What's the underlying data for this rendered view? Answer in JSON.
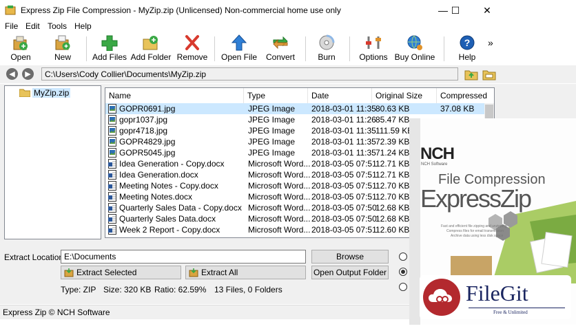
{
  "window": {
    "title": "Express Zip File Compression - MyZip.zip (Unlicensed) Non-commercial home use only",
    "minimize_glyph": "—",
    "maximize_glyph": "☐",
    "close_glyph": "✕"
  },
  "menu": [
    "File",
    "Edit",
    "Tools",
    "Help"
  ],
  "toolbar": {
    "open": "Open",
    "new": "New",
    "add_files": "Add Files",
    "add_folder": "Add Folder",
    "remove": "Remove",
    "open_file": "Open File",
    "convert": "Convert",
    "burn": "Burn",
    "options": "Options",
    "buy_online": "Buy Online",
    "help": "Help",
    "overflow": "»"
  },
  "address": {
    "path": "C:\\Users\\Cody Collier\\Documents\\MyZip.zip"
  },
  "tree": {
    "root": "MyZip.zip"
  },
  "list": {
    "columns": [
      "Name",
      "Type",
      "Date",
      "Original Size",
      "Compressed"
    ],
    "rows": [
      {
        "name": "GOPR0691.jpg",
        "type": "JPEG Image",
        "date": "2018-03-01 11:35",
        "size": "80.63 KB",
        "comp": "37.08 KB",
        "kind": "jpg"
      },
      {
        "name": "gopr1037.jpg",
        "type": "JPEG Image",
        "date": "2018-03-01 11:26",
        "size": "85.47 KB",
        "comp": "",
        "kind": "jpg"
      },
      {
        "name": "gopr4718.jpg",
        "type": "JPEG Image",
        "date": "2018-03-01 11:35",
        "size": "111.59 KB",
        "comp": "",
        "kind": "jpg"
      },
      {
        "name": "GOPR4829.jpg",
        "type": "JPEG Image",
        "date": "2018-03-01 11:35",
        "size": "72.39 KB",
        "comp": "",
        "kind": "jpg"
      },
      {
        "name": "GOPR5045.jpg",
        "type": "JPEG Image",
        "date": "2018-03-01 11:35",
        "size": "71.24 KB",
        "comp": "",
        "kind": "jpg"
      },
      {
        "name": "Idea Generation - Copy.docx",
        "type": "Microsoft Word...",
        "date": "2018-03-05 07:51",
        "size": "12.71 KB",
        "comp": "",
        "kind": "doc"
      },
      {
        "name": "Idea Generation.docx",
        "type": "Microsoft Word...",
        "date": "2018-03-05 07:51",
        "size": "12.71 KB",
        "comp": "",
        "kind": "doc"
      },
      {
        "name": "Meeting Notes - Copy.docx",
        "type": "Microsoft Word...",
        "date": "2018-03-05 07:51",
        "size": "12.70 KB",
        "comp": "",
        "kind": "doc"
      },
      {
        "name": "Meeting Notes.docx",
        "type": "Microsoft Word...",
        "date": "2018-03-05 07:51",
        "size": "12.70 KB",
        "comp": "",
        "kind": "doc"
      },
      {
        "name": "Quarterly Sales Data - Copy.docx",
        "type": "Microsoft Word...",
        "date": "2018-03-05 07:50",
        "size": "12.68 KB",
        "comp": "",
        "kind": "doc"
      },
      {
        "name": "Quarterly Sales Data.docx",
        "type": "Microsoft Word...",
        "date": "2018-03-05 07:50",
        "size": "12.68 KB",
        "comp": "",
        "kind": "doc"
      },
      {
        "name": "Week 2 Report - Copy.docx",
        "type": "Microsoft Word...",
        "date": "2018-03-05 07:51",
        "size": "12.60 KB",
        "comp": "",
        "kind": "doc"
      }
    ]
  },
  "extract": {
    "location_label": "Extract Location:",
    "location_value": "E:\\Documents",
    "browse": "Browse",
    "open_output": "Open Output Folder",
    "extract_selected": "Extract Selected",
    "extract_all": "Extract All"
  },
  "info": {
    "type": "Type: ZIP",
    "size": "Size: 320 KB",
    "ratio": "Ratio: 62.59%",
    "files": "13 Files, 0 Folders"
  },
  "status": "Express Zip © NCH Software",
  "promo": {
    "brand": "NCH",
    "brand_sub": "NCH Software",
    "line1": "File Compression",
    "line2": "ExpressZip",
    "blurb1": "Fast and efficient file zipping and unzipping",
    "blurb2": "Compress files for email transmission",
    "blurb3": "Archive data using less disk space"
  },
  "watermark": {
    "name": "FileGit",
    "tagline": "Free & Unlimited"
  },
  "colors": {
    "selection": "#cce8ff",
    "green": "#3aa845",
    "blue": "#1e6fd0",
    "red": "#d83a2e"
  }
}
